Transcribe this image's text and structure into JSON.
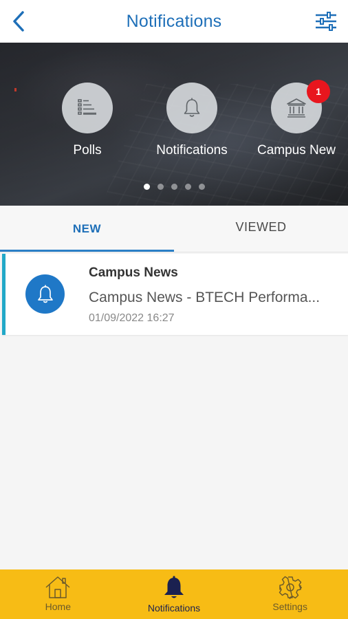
{
  "header": {
    "title": "Notifications",
    "back_icon": "chevron-left-icon",
    "filter_icon": "sliders-icon"
  },
  "banner": {
    "shortcuts": [
      {
        "label": "Polls",
        "icon": "list-icon"
      },
      {
        "label": "Notifications",
        "icon": "bell-icon"
      },
      {
        "label": "Campus New",
        "icon": "bank-icon",
        "badge": "1"
      }
    ],
    "pager": {
      "total": 5,
      "active": 1
    }
  },
  "tabs": [
    {
      "label": "NEW",
      "active": true
    },
    {
      "label": "VIEWED",
      "active": false
    }
  ],
  "notifications": [
    {
      "title": "Campus News",
      "body": "Campus News - BTECH Performa...",
      "timestamp": "01/09/2022 16:27",
      "icon": "bell-icon"
    }
  ],
  "bottom_nav": [
    {
      "label": "Home",
      "icon": "home-icon"
    },
    {
      "label": "Notifications",
      "icon": "bell-icon",
      "active": true
    },
    {
      "label": "Settings",
      "icon": "gear-icon"
    }
  ],
  "colors": {
    "accent": "#1e6fb8",
    "nav_background": "#f7bc15",
    "badge": "#e8161e",
    "card_stripe": "#21a8c8"
  }
}
